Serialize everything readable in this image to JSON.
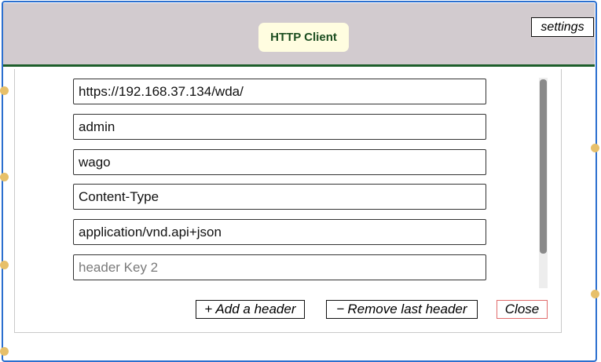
{
  "header": {
    "title": "HTTP Client",
    "settings_label": "settings"
  },
  "fields": [
    {
      "value": "https://192.168.37.134/wda/",
      "placeholder": ""
    },
    {
      "value": "admin",
      "placeholder": ""
    },
    {
      "value": "wago",
      "placeholder": ""
    },
    {
      "value": "Content-Type",
      "placeholder": ""
    },
    {
      "value": "application/vnd.api+json",
      "placeholder": ""
    },
    {
      "value": "",
      "placeholder": "header Key 2"
    }
  ],
  "buttons": {
    "add_symbol": "+",
    "add_label": "Add a header",
    "remove_symbol": "−",
    "remove_label": "Remove last header",
    "close_label": "Close"
  },
  "colors": {
    "header_bg": "#d2cbcf",
    "header_border": "#1e5f2c",
    "title_badge_bg": "#fffde0",
    "frame_border": "#2b6fcf",
    "close_border": "#e06b6b",
    "handle_dot": "#e7c06a"
  }
}
